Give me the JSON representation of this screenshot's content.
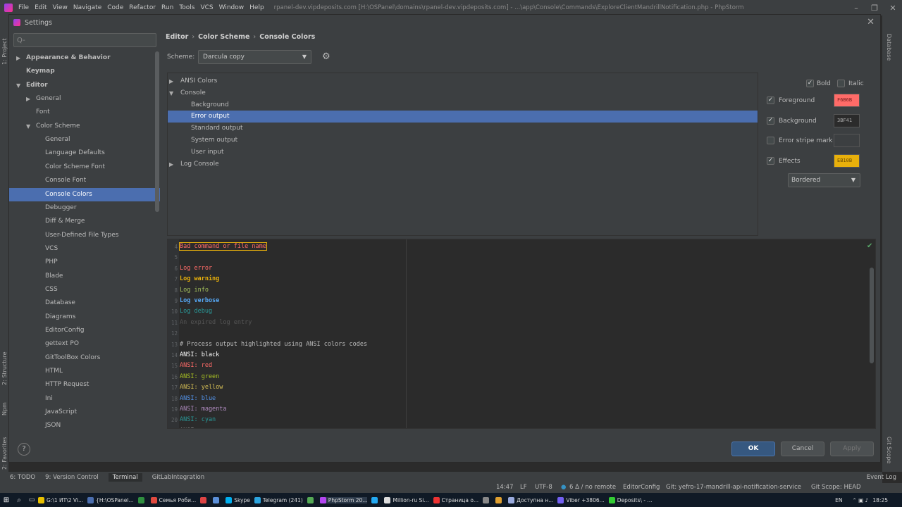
{
  "menubar": {
    "items": [
      "File",
      "Edit",
      "View",
      "Navigate",
      "Code",
      "Refactor",
      "Run",
      "Tools",
      "VCS",
      "Window",
      "Help"
    ],
    "window_title": "rpanel-dev.vipdeposits.com [H:\\OSPanel\\domains\\rpanel-dev.vipdeposits.com] - ...\\app\\Console\\Commands\\ExploreClientMandrillNotification.php - PhpStorm"
  },
  "side_tools": {
    "left": [
      "1: Project",
      "2: Structure",
      "Npm",
      "2: Favorites"
    ],
    "right": [
      "Database",
      "Git Scope"
    ]
  },
  "dialog": {
    "title": "Settings",
    "search_placeholder": "Q-",
    "tree": [
      {
        "label": "Appearance & Behavior",
        "level": 0,
        "bold": true,
        "arrow": "right"
      },
      {
        "label": "Keymap",
        "level": 0,
        "bold": true,
        "arrow": ""
      },
      {
        "label": "Editor",
        "level": 0,
        "bold": true,
        "arrow": "down"
      },
      {
        "label": "General",
        "level": 1,
        "arrow": "right"
      },
      {
        "label": "Font",
        "level": 1,
        "arrow": ""
      },
      {
        "label": "Color Scheme",
        "level": 1,
        "arrow": "down"
      },
      {
        "label": "General",
        "level": 2,
        "arrow": ""
      },
      {
        "label": "Language Defaults",
        "level": 2,
        "arrow": ""
      },
      {
        "label": "Color Scheme Font",
        "level": 2,
        "arrow": ""
      },
      {
        "label": "Console Font",
        "level": 2,
        "arrow": ""
      },
      {
        "label": "Console Colors",
        "level": 2,
        "arrow": "",
        "selected": true
      },
      {
        "label": "Debugger",
        "level": 2,
        "arrow": ""
      },
      {
        "label": "Diff & Merge",
        "level": 2,
        "arrow": ""
      },
      {
        "label": "User-Defined File Types",
        "level": 2,
        "arrow": ""
      },
      {
        "label": "VCS",
        "level": 2,
        "arrow": ""
      },
      {
        "label": "PHP",
        "level": 2,
        "arrow": ""
      },
      {
        "label": "Blade",
        "level": 2,
        "arrow": ""
      },
      {
        "label": "CSS",
        "level": 2,
        "arrow": ""
      },
      {
        "label": "Database",
        "level": 2,
        "arrow": ""
      },
      {
        "label": "Diagrams",
        "level": 2,
        "arrow": ""
      },
      {
        "label": "EditorConfig",
        "level": 2,
        "arrow": ""
      },
      {
        "label": "gettext PO",
        "level": 2,
        "arrow": ""
      },
      {
        "label": "GitToolBox Colors",
        "level": 2,
        "arrow": ""
      },
      {
        "label": "HTML",
        "level": 2,
        "arrow": ""
      },
      {
        "label": "HTTP Request",
        "level": 2,
        "arrow": ""
      },
      {
        "label": "Ini",
        "level": 2,
        "arrow": ""
      },
      {
        "label": "JavaScript",
        "level": 2,
        "arrow": ""
      },
      {
        "label": "JSON",
        "level": 2,
        "arrow": ""
      }
    ],
    "breadcrumb": [
      "Editor",
      "Color Scheme",
      "Console Colors"
    ],
    "scheme_label": "Scheme:",
    "scheme_value": "Darcula copy",
    "categories": [
      {
        "label": "ANSI Colors",
        "level": 0,
        "arrow": "right"
      },
      {
        "label": "Console",
        "level": 0,
        "arrow": "down"
      },
      {
        "label": "Background",
        "level": 1,
        "arrow": ""
      },
      {
        "label": "Error output",
        "level": 1,
        "arrow": "",
        "selected": true
      },
      {
        "label": "Standard output",
        "level": 1,
        "arrow": ""
      },
      {
        "label": "System output",
        "level": 1,
        "arrow": ""
      },
      {
        "label": "User input",
        "level": 1,
        "arrow": ""
      },
      {
        "label": "Log Console",
        "level": 0,
        "arrow": "right"
      }
    ],
    "props": {
      "bold": {
        "label": "Bold",
        "checked": true
      },
      "italic": {
        "label": "Italic",
        "checked": false
      },
      "foreground": {
        "label": "Foreground",
        "checked": true,
        "value": "F6B6B",
        "color": "#ff6b68"
      },
      "background": {
        "label": "Background",
        "checked": true,
        "value": "3BF41",
        "color": "#2b2b2b"
      },
      "error_stripe": {
        "label": "Error stripe mark",
        "checked": false,
        "value": ""
      },
      "effects": {
        "label": "Effects",
        "checked": true,
        "value": "EB10B",
        "color": "#e8b00b"
      },
      "effect_type": "Bordered"
    },
    "preview_lines": [
      {
        "n": "4",
        "t": "Bad command or file name",
        "c": "#ff6b68",
        "box": true
      },
      {
        "n": "5",
        "t": "",
        "c": "#bbbbbb"
      },
      {
        "n": "6",
        "t": "Log error",
        "c": "#ff6b68"
      },
      {
        "n": "7",
        "t": "Log warning",
        "c": "#e8b00b",
        "bold": true
      },
      {
        "n": "8",
        "t": "Log info",
        "c": "#a5c25c"
      },
      {
        "n": "9",
        "t": "Log verbose",
        "c": "#56a8f5",
        "bold": true
      },
      {
        "n": "10",
        "t": "Log debug",
        "c": "#299999"
      },
      {
        "n": "11",
        "t": "An expired log entry",
        "c": "#555555"
      },
      {
        "n": "12",
        "t": "",
        "c": "#bbbbbb"
      },
      {
        "n": "13",
        "t": "# Process output highlighted using ANSI colors codes",
        "c": "#bbbbbb"
      },
      {
        "n": "14",
        "t": "ANSI: black",
        "c": "#ffffff"
      },
      {
        "n": "15",
        "t": "ANSI: red",
        "c": "#ff6b68"
      },
      {
        "n": "16",
        "t": "ANSI: green",
        "c": "#a8c023"
      },
      {
        "n": "17",
        "t": "ANSI: yellow",
        "c": "#d6bf55"
      },
      {
        "n": "18",
        "t": "ANSI: blue",
        "c": "#5394ec"
      },
      {
        "n": "19",
        "t": "ANSI: magenta",
        "c": "#ae8abe"
      },
      {
        "n": "20",
        "t": "ANSI: cyan",
        "c": "#299999"
      },
      {
        "n": "21",
        "t": "ANSI: ...",
        "c": "#bbbbbb"
      }
    ],
    "buttons": {
      "help": "?",
      "ok": "OK",
      "cancel": "Cancel",
      "apply": "Apply"
    }
  },
  "toolwindows": [
    "6: TODO",
    "9: Version Control",
    "Terminal",
    "GitLabIntegration"
  ],
  "event_log": "Event Log",
  "statusbar": {
    "time_pos": "14:47",
    "line_sep": "LF",
    "encoding": "UTF-8",
    "changes": "6 Δ / no remote",
    "editorconfig": "EditorConfig",
    "git": "Git: yefro-17-mandrill-api-notification-service",
    "scope": "Git Scope: HEAD"
  },
  "taskbar": {
    "items": [
      {
        "label": "G:\\1 ИТ\\2 Vi...",
        "color": "#e8c000"
      },
      {
        "label": "{H:\\OSPanel...",
        "color": "#4b6eaf"
      },
      {
        "label": "",
        "color": "#2f8f3f"
      },
      {
        "label": "Семья Роби...",
        "color": "#e04a3f"
      },
      {
        "label": "",
        "color": "#d44"
      },
      {
        "label": "",
        "color": "#5b8fd8"
      },
      {
        "label": "Skype",
        "color": "#00aff0"
      },
      {
        "label": "Telegram (241)",
        "color": "#2ca5e0"
      },
      {
        "label": "",
        "color": "#5a5"
      },
      {
        "label": "PhpStorm 20...",
        "color": "#b345f1",
        "active": true
      },
      {
        "label": "",
        "color": "#23a9f2"
      },
      {
        "label": "Million-ru Si...",
        "color": "#ddd"
      },
      {
        "label": "Страница о...",
        "color": "#e33"
      },
      {
        "label": "",
        "color": "#888"
      },
      {
        "label": "",
        "color": "#e0a030"
      },
      {
        "label": "Доступна н...",
        "color": "#9ad"
      },
      {
        "label": "Viber +3806...",
        "color": "#7360f2"
      },
      {
        "label": "Deposits\\ - ...",
        "color": "#3c3"
      }
    ],
    "lang": "EN",
    "clock": "18:25"
  }
}
